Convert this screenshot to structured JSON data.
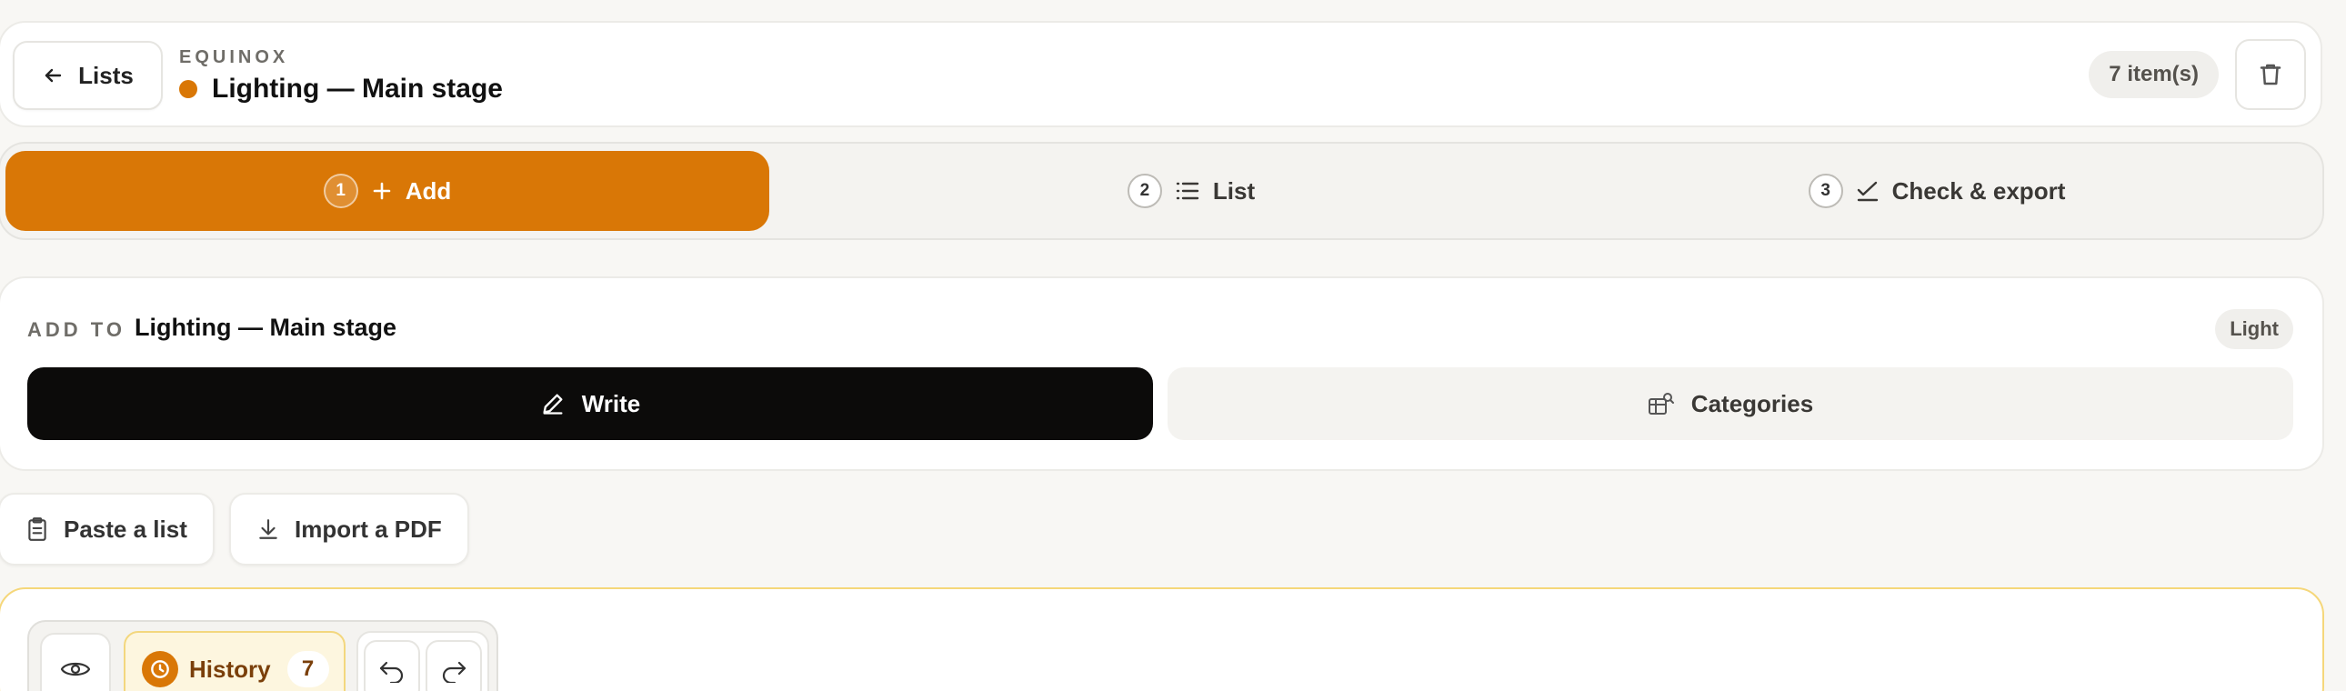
{
  "header": {
    "back_label": "Lists",
    "eyebrow": "EQUINOX",
    "title": "Lighting — Main stage",
    "item_count": "7 item(s)"
  },
  "steps": [
    {
      "number": "1",
      "label": "Add",
      "icon": "plus-icon",
      "active": true
    },
    {
      "number": "2",
      "label": "List",
      "icon": "list-icon",
      "active": false
    },
    {
      "number": "3",
      "label": "Check & export",
      "icon": "check-icon",
      "active": false
    }
  ],
  "add_to": {
    "label": "ADD TO",
    "target": "Lighting — Main stage",
    "category_badge": "Light",
    "modes": [
      {
        "label": "Write",
        "icon": "pencil-icon",
        "active": true
      },
      {
        "label": "Categories",
        "icon": "categories-icon",
        "active": false
      }
    ]
  },
  "actions": [
    {
      "label": "Paste a list",
      "icon": "clipboard-icon"
    },
    {
      "label": "Import a PDF",
      "icon": "download-icon"
    }
  ],
  "editor_toolbar": {
    "preview_icon": "eye-icon",
    "history_label": "History",
    "history_count": "7",
    "undo_icon": "undo-icon",
    "redo_icon": "redo-icon"
  },
  "colors": {
    "accent": "#d97706",
    "background": "#f8f7f4",
    "active_mode": "#0c0b0a",
    "editor_border": "#f5d77a"
  }
}
